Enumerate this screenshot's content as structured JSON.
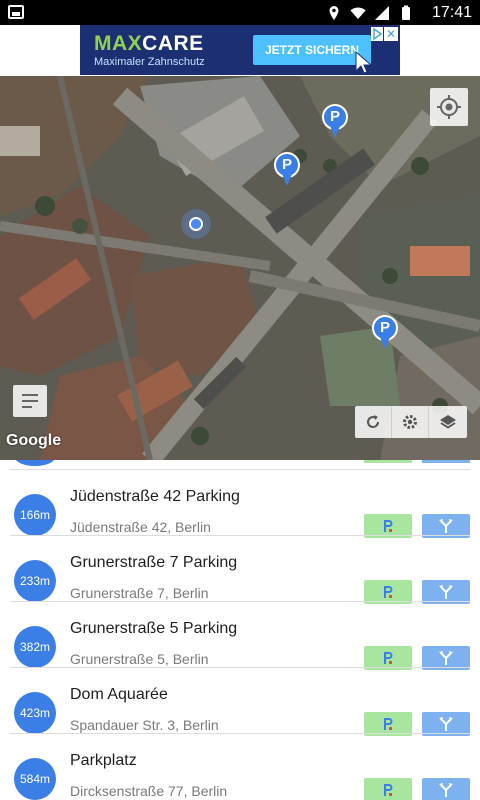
{
  "status_bar": {
    "time": "17:41",
    "icons": [
      "gallery-icon",
      "location-icon",
      "wifi-icon",
      "signal-icon",
      "battery-icon"
    ]
  },
  "ad": {
    "logo_part1": "MAX",
    "logo_part2": "CARE",
    "tagline": "Maximaler Zahnschutz",
    "cta": "JETZT SICHERN",
    "close": "✕"
  },
  "map": {
    "attribution": "Google",
    "pins_label": "P",
    "controls": [
      "my-location",
      "list-toggle",
      "refresh",
      "settings",
      "layers"
    ]
  },
  "list": {
    "items": [
      {
        "distance": "166m",
        "name": "Jüdenstraße 42 Parking",
        "address": "Jüdenstraße 42, Berlin"
      },
      {
        "distance": "233m",
        "name": "Grunerstraße 7 Parking",
        "address": "Grunerstraße 7, Berlin"
      },
      {
        "distance": "382m",
        "name": "Grunerstraße 5 Parking",
        "address": "Grunerstraße 5, Berlin"
      },
      {
        "distance": "423m",
        "name": "Dom Aquarée",
        "address": "Spandauer Str. 3, Berlin"
      },
      {
        "distance": "584m",
        "name": "Parkplatz",
        "address": "Dircksenstraße 77, Berlin"
      }
    ]
  },
  "colors": {
    "accent": "#3b7fe6",
    "park_button": "#a8e6a0",
    "nav_button": "#7db1ef",
    "ad_background": "#1d2f73",
    "ad_cta": "#4dc1ff"
  }
}
